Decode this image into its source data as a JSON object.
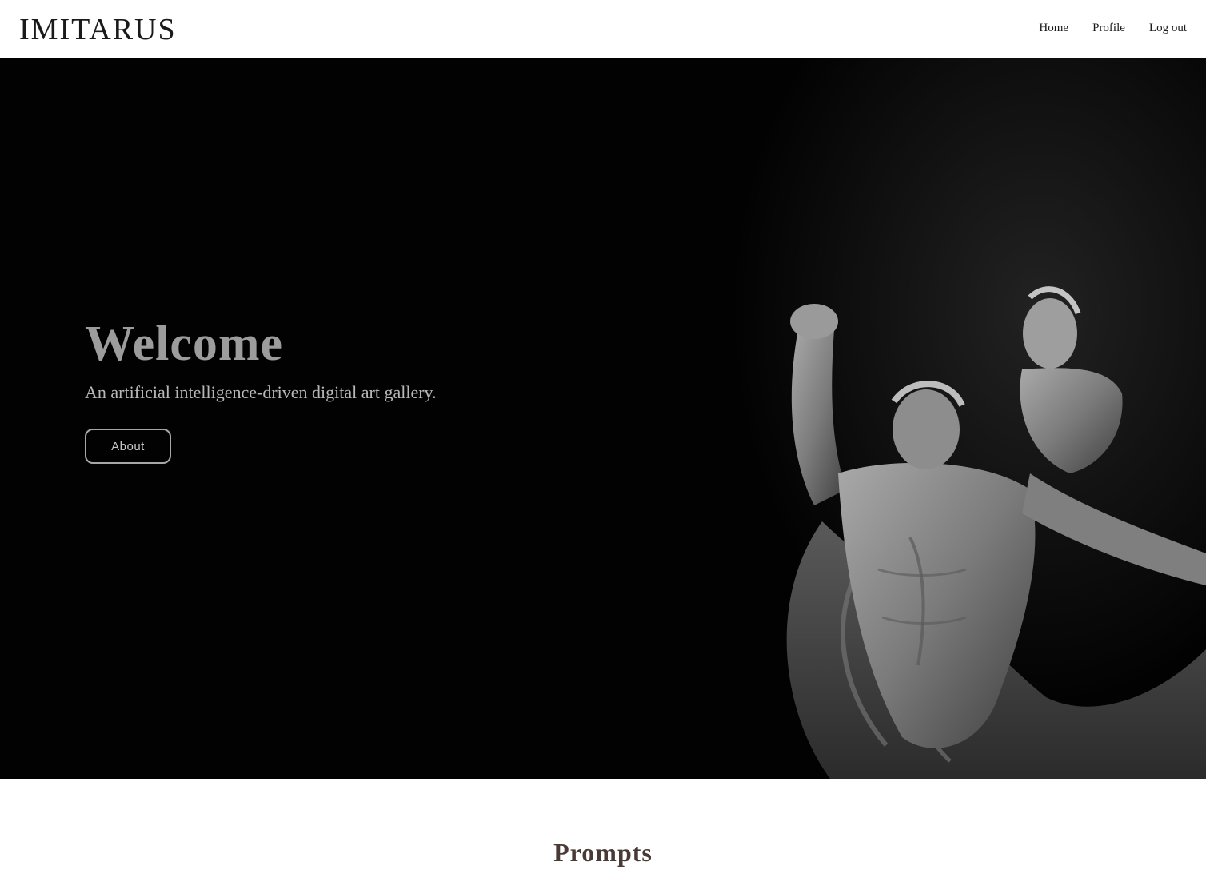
{
  "header": {
    "logo": "IMITARUS",
    "nav": [
      {
        "label": "Home"
      },
      {
        "label": "Profile"
      },
      {
        "label": "Log out"
      }
    ]
  },
  "hero": {
    "title": "Welcome",
    "subtitle": "An artificial intelligence-driven digital art gallery.",
    "button_label": "About",
    "image_icon": "marble-statue-image"
  },
  "prompts": {
    "title": "Prompts"
  },
  "colors": {
    "hero_background": "#020203",
    "title_text": "#9c9c9c",
    "section_title": "#4a3a36"
  }
}
